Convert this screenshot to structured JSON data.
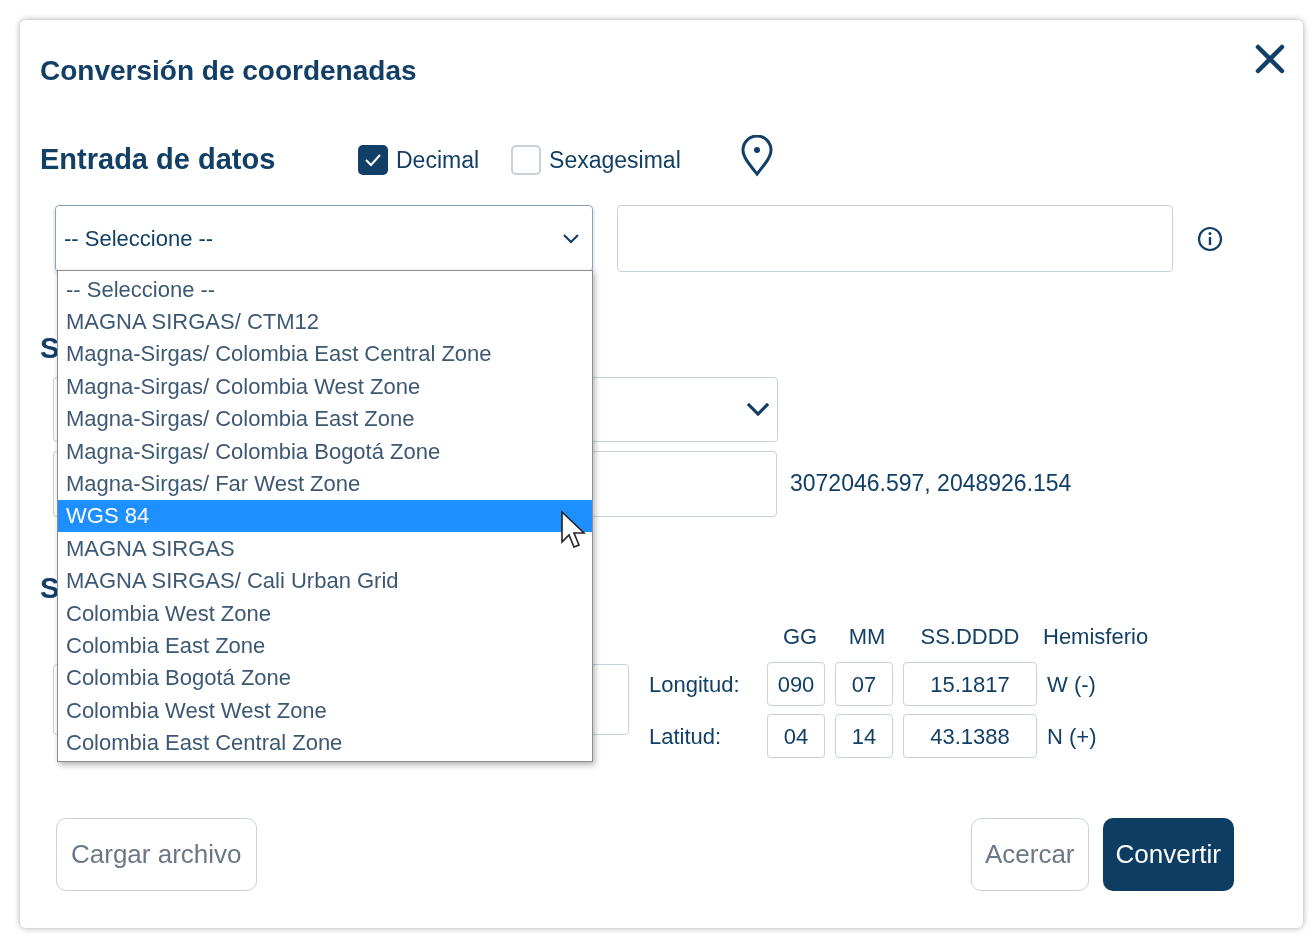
{
  "dialog": {
    "title": "Conversión de coordenadas"
  },
  "input_section": {
    "heading": "Entrada de datos",
    "formats": [
      {
        "label": "Decimal",
        "checked": true
      },
      {
        "label": "Sexagesimal",
        "checked": false
      }
    ],
    "system_select": {
      "value": "-- Seleccione --",
      "expanded": true
    }
  },
  "dropdown_options": [
    {
      "label": "-- Seleccione --",
      "selected": false
    },
    {
      "label": "MAGNA SIRGAS/ CTM12",
      "selected": false
    },
    {
      "label": "Magna-Sirgas/ Colombia East Central Zone",
      "selected": false
    },
    {
      "label": "Magna-Sirgas/ Colombia West Zone",
      "selected": false
    },
    {
      "label": "Magna-Sirgas/ Colombia East Zone",
      "selected": false
    },
    {
      "label": "Magna-Sirgas/ Colombia Bogotá Zone",
      "selected": false
    },
    {
      "label": "Magna-Sirgas/ Far West Zone",
      "selected": false
    },
    {
      "label": "WGS 84",
      "selected": true
    },
    {
      "label": "MAGNA SIRGAS",
      "selected": false
    },
    {
      "label": "MAGNA SIRGAS/ Cali Urban Grid",
      "selected": false
    },
    {
      "label": "Colombia West Zone",
      "selected": false
    },
    {
      "label": "Colombia East Zone",
      "selected": false
    },
    {
      "label": "Colombia Bogotá Zone",
      "selected": false
    },
    {
      "label": "Colombia West West Zone",
      "selected": false
    },
    {
      "label": "Colombia East Central Zone",
      "selected": false
    }
  ],
  "output_section": {
    "heading": "S",
    "converted_value": "3072046.597, 2048926.154"
  },
  "sexagesimal_section": {
    "heading": "S",
    "columns": [
      "GG",
      "MM",
      "SS.DDDD",
      "Hemisferio"
    ],
    "rows": [
      {
        "label": "Longitud:",
        "gg": "090",
        "mm": "07",
        "ss": "15.1817",
        "hemisphere": "W (-)"
      },
      {
        "label": "Latitud:",
        "gg": "04",
        "mm": "14",
        "ss": "43.1388",
        "hemisphere": "N (+)"
      }
    ]
  },
  "buttons": {
    "upload": "Cargar archivo",
    "zoom": "Acercar",
    "convert": "Convertir"
  }
}
